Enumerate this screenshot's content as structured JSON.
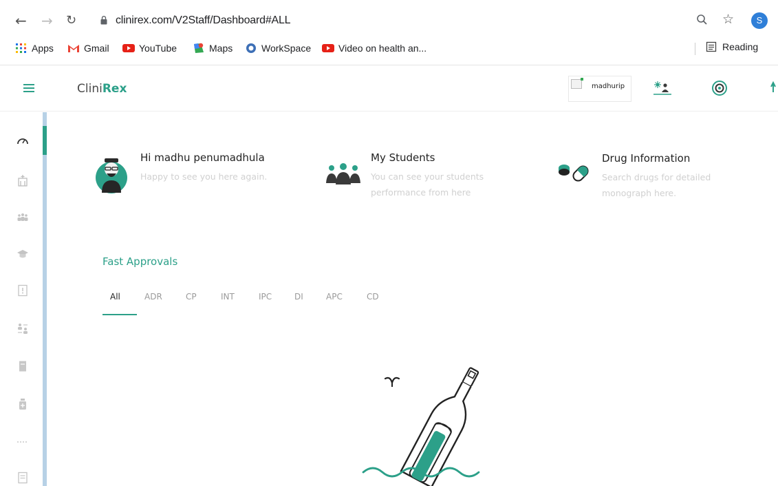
{
  "browser": {
    "url": "clinirex.com/V2Staff/Dashboard#ALL",
    "profile_initial": "S",
    "bookmarks": [
      {
        "label": "Apps",
        "icon": "apps-grid-icon"
      },
      {
        "label": "Gmail",
        "icon": "gmail-icon"
      },
      {
        "label": "YouTube",
        "icon": "youtube-icon"
      },
      {
        "label": "Maps",
        "icon": "maps-icon"
      },
      {
        "label": "WorkSpace",
        "icon": "workspace-icon"
      },
      {
        "label": "Video on health an...",
        "icon": "youtube-icon"
      }
    ],
    "reading_list": "Reading"
  },
  "app": {
    "brand_prefix": "Clini",
    "brand_suffix": "Rex",
    "username": "madhurip",
    "accent": "#2ca089"
  },
  "cards": [
    {
      "title": "Hi madhu penumadhula",
      "subtitle": "Happy to see you here again.",
      "icon": "avatar-icon"
    },
    {
      "title": "My Students",
      "subtitle": "You can see your students performance from here",
      "icon": "students-icon"
    },
    {
      "title": "Drug Information",
      "subtitle": "Search drugs for detailed monograph here.",
      "icon": "pills-icon"
    }
  ],
  "fast_approvals": {
    "title": "Fast Approvals",
    "tabs": [
      "All",
      "ADR",
      "CP",
      "INT",
      "IPC",
      "DI",
      "APC",
      "CD"
    ],
    "active_tab": "All"
  }
}
